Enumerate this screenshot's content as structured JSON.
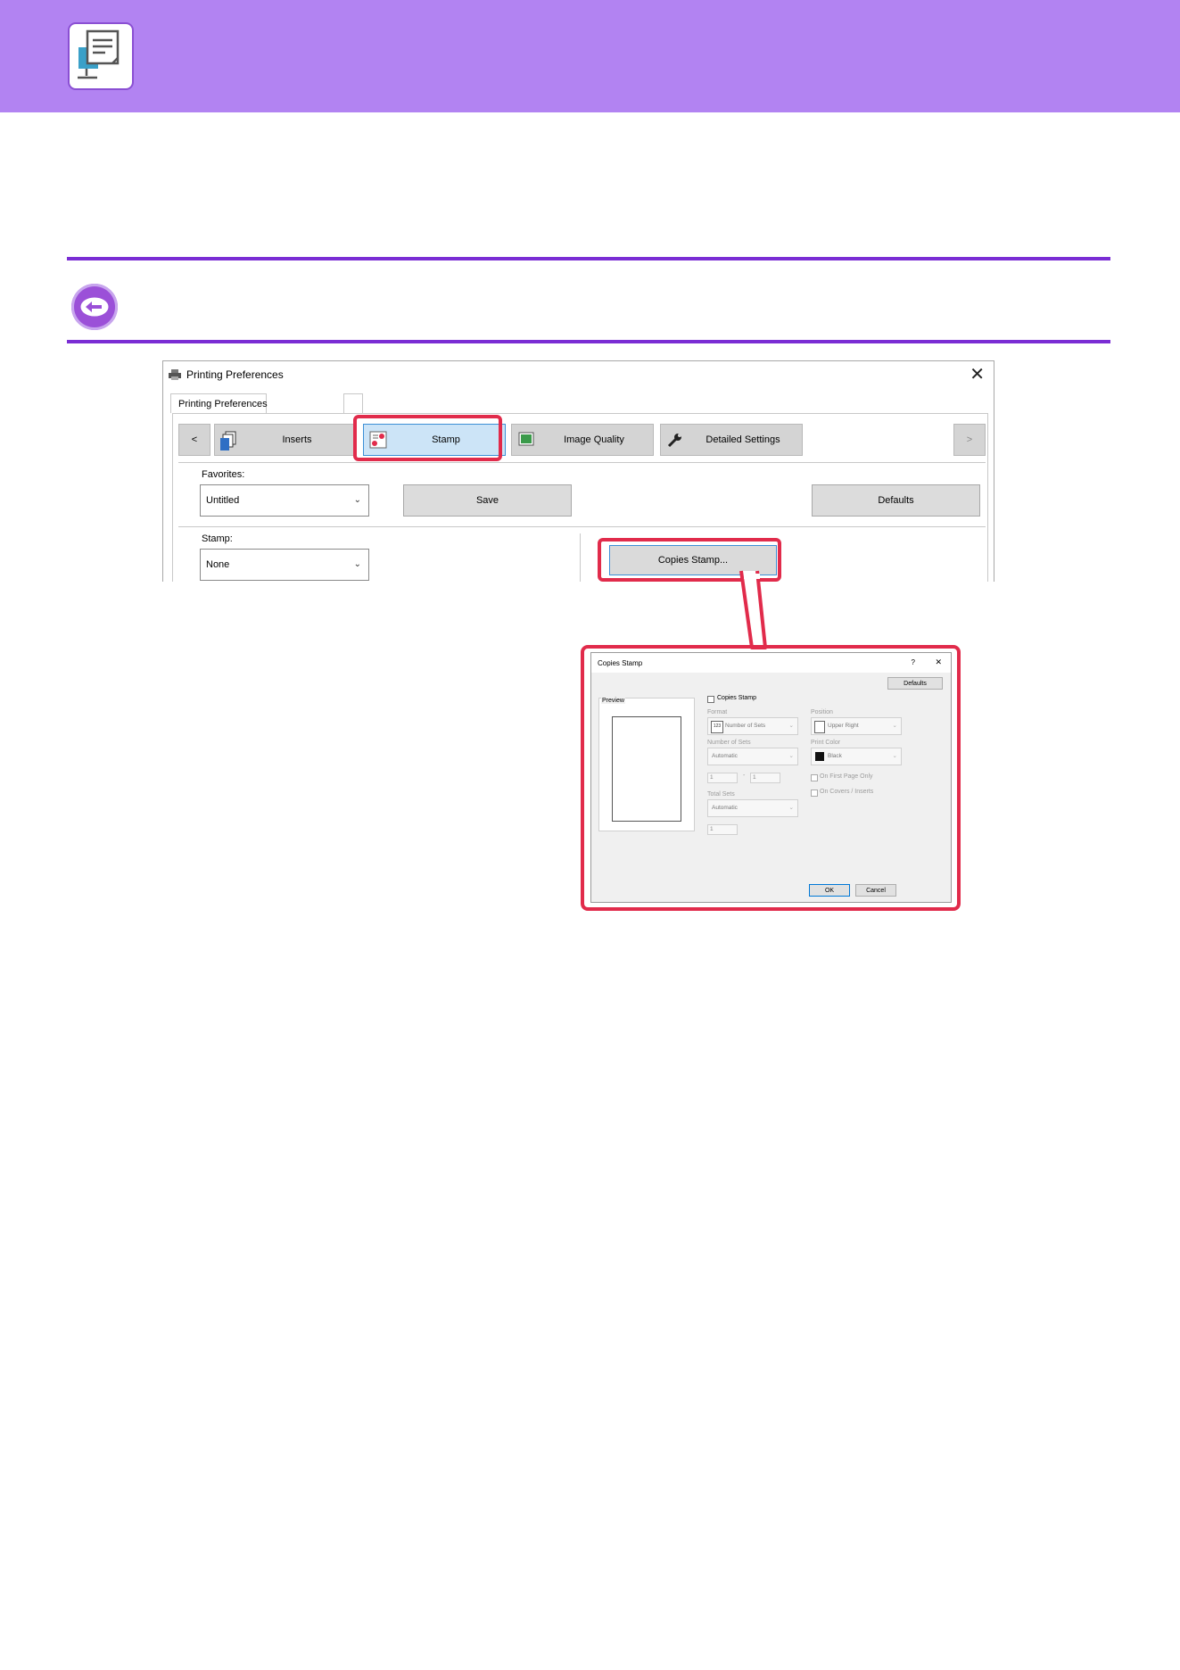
{
  "window": {
    "title": "Printing Preferences",
    "tab_label": "Printing Preferences",
    "nav": {
      "prev": "<",
      "next": ">",
      "items": [
        {
          "label": "Inserts"
        },
        {
          "label": "Stamp"
        },
        {
          "label": "Image Quality"
        },
        {
          "label": "Detailed Settings"
        }
      ]
    },
    "favorites": {
      "label": "Favorites:",
      "value": "Untitled"
    },
    "save_label": "Save",
    "defaults_label": "Defaults",
    "stamp": {
      "label": "Stamp:",
      "value": "None"
    },
    "copies_stamp_button": "Copies Stamp..."
  },
  "dialog": {
    "title": "Copies Stamp",
    "help": "?",
    "close": "✕",
    "defaults_label": "Defaults",
    "preview_label": "Preview",
    "copies_stamp_checkbox": "Copies Stamp",
    "format": {
      "label": "Format",
      "value": "Number of Sets",
      "badge": "123"
    },
    "number_of_sets": {
      "label": "Number of Sets",
      "value": "Automatic",
      "from": "1",
      "sep": "-",
      "to": "1"
    },
    "total_sets": {
      "label": "Total Sets",
      "value": "Automatic",
      "input": "1"
    },
    "position": {
      "label": "Position",
      "value": "Upper Right"
    },
    "print_color": {
      "label": "Print Color",
      "value": "Black"
    },
    "on_first_page_only": "On First Page Only",
    "on_covers_inserts": "On Covers / Inserts",
    "ok_label": "OK",
    "cancel_label": "Cancel"
  },
  "colors": {
    "band": "#b283f2",
    "rule": "#7a2dd4",
    "highlight": "#e12b4b",
    "selected_tab": "#cce4f7"
  }
}
